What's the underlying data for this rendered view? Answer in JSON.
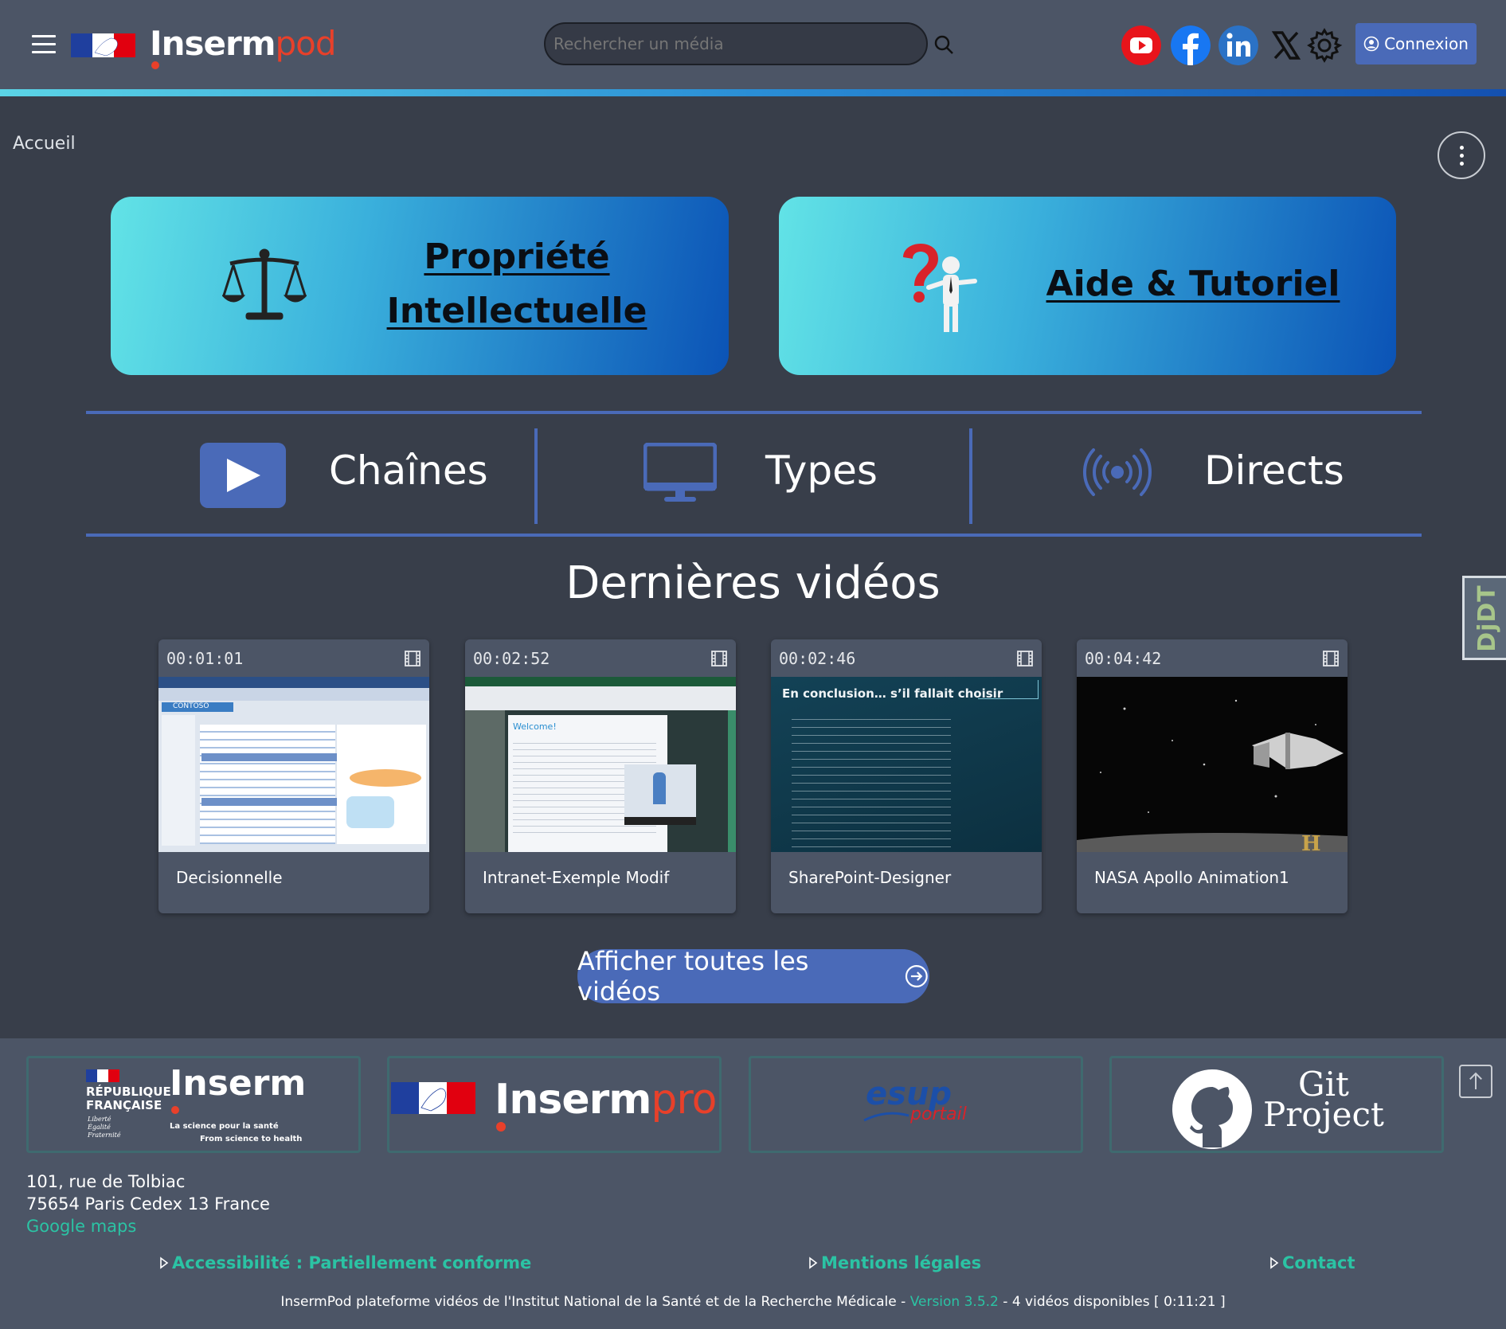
{
  "header": {
    "brand_main": "Inserm",
    "brand_accent": "pod",
    "search_placeholder": "Rechercher un média",
    "login_label": "Connexion",
    "social": [
      "youtube-icon",
      "facebook-icon",
      "linkedin-icon",
      "x-icon"
    ]
  },
  "breadcrumb": "Accueil",
  "banners": {
    "left_line1": "Propriété",
    "left_line2": "Intellectuelle",
    "right": "Aide & Tutoriel"
  },
  "nav": {
    "chaines": "Chaînes",
    "types": "Types",
    "directs": "Directs"
  },
  "latest": {
    "title": "Dernières vidéos",
    "videos": [
      {
        "duration": "00:01:01",
        "title": "Decisionnelle"
      },
      {
        "duration": "00:02:52",
        "title": "Intranet-Exemple Modif"
      },
      {
        "duration": "00:02:46",
        "title": "SharePoint-Designer"
      },
      {
        "duration": "00:04:42",
        "title": "NASA Apollo Animation1"
      }
    ],
    "thumb_texts": {
      "contoso": "CONTOSO",
      "welcome": "Welcome!",
      "conclusion": "En conclusion… s’il fallait choisir"
    },
    "all_label": "Afficher toutes les vidéos"
  },
  "debug_toolbar": "DjDT",
  "footer": {
    "logos": {
      "rf_line1": "RÉPUBLIQUE",
      "rf_line2": "FRANÇAISE",
      "rf_motto1": "Liberté",
      "rf_motto2": "Égalité",
      "rf_motto3": "Fraternité",
      "inserm": "Inserm",
      "inserm_tag1": "La science pour la santé",
      "inserm_tag2": "From science to health",
      "pro_main": "Inserm",
      "pro_accent": "pro",
      "esup_main": "esup",
      "esup_sub": "portail",
      "git_line1": "Git",
      "git_line2": "Project"
    },
    "address_line1": "101, rue de Tolbiac",
    "address_line2": "75654 Paris Cedex 13 France",
    "maps_link": "Google maps",
    "links": {
      "accessibility": "Accessibilité : Partiellement conforme",
      "legal": "Mentions légales",
      "contact": "Contact"
    },
    "bottom_prefix": "InsermPod plateforme vidéos de l'Institut National de la Santé et de la Recherche Médicale - ",
    "version": "Version 3.5.2",
    "bottom_suffix": " - 4 vidéos disponibles [ 0:11:21 ]"
  }
}
